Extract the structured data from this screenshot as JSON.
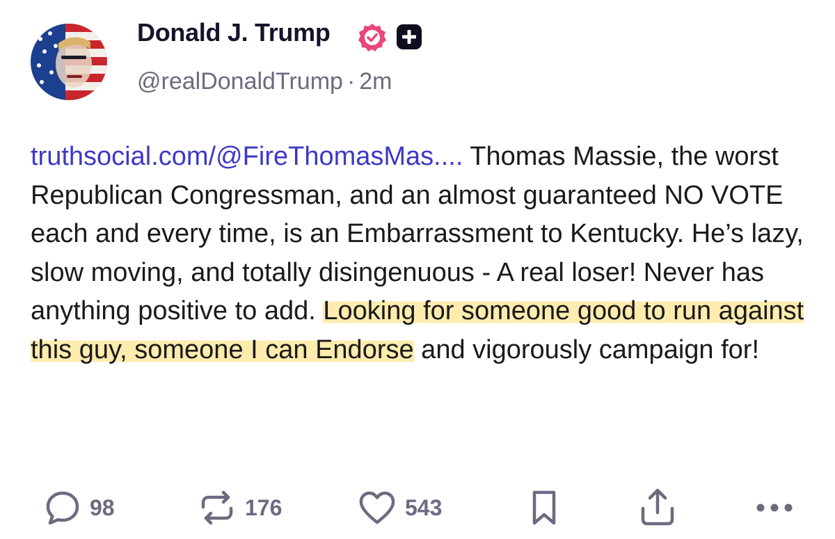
{
  "author": {
    "display_name": "Donald J. Trump",
    "handle": "@realDonaldTrump",
    "separator": "·",
    "time": "2m"
  },
  "post": {
    "link": "truthsocial.com/@FireThomasMas....",
    "text_plain": " Thomas Massie, the worst Republican Congressman, and an almost guaranteed NO VOTE each and every time, is an Embarrassment to Kentucky. He’s lazy, slow moving, and totally disingenuous - A real loser! Never has anything positive to add. ",
    "text_highlighted": "Looking for someone good to run against this guy, someone I can Endorse",
    "text_end": " and vigorously campaign for!"
  },
  "actions": {
    "reply_count": "98",
    "repost_count": "176",
    "like_count": "543"
  },
  "colors": {
    "link": "#3d39c4",
    "verified": "#e8467c",
    "highlight": "#fde9a0",
    "muted": "#6b6b80"
  },
  "icons": [
    "verified-icon",
    "plus-icon",
    "reply-icon",
    "repost-icon",
    "heart-icon",
    "bookmark-icon",
    "share-icon",
    "more-icon"
  ]
}
